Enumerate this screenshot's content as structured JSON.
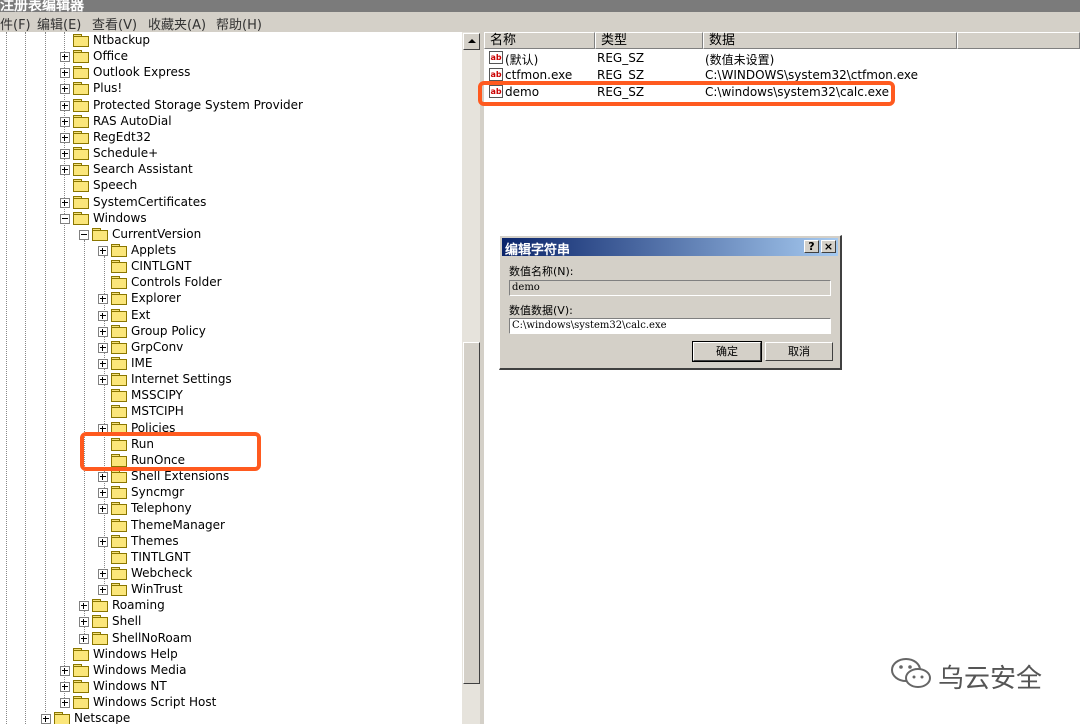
{
  "app": {
    "title": "注册表编辑器"
  },
  "menu": [
    "件(F)",
    "编辑(E)",
    "查看(V)",
    "收藏夹(A)",
    "帮助(H)"
  ],
  "tree": [
    {
      "label": "Ntbackup",
      "level": 3,
      "exp": "none"
    },
    {
      "label": "Office",
      "level": 3,
      "exp": "plus"
    },
    {
      "label": "Outlook Express",
      "level": 3,
      "exp": "plus"
    },
    {
      "label": "Plus!",
      "level": 3,
      "exp": "plus"
    },
    {
      "label": "Protected Storage System Provider",
      "level": 3,
      "exp": "plus"
    },
    {
      "label": "RAS AutoDial",
      "level": 3,
      "exp": "plus"
    },
    {
      "label": "RegEdt32",
      "level": 3,
      "exp": "plus"
    },
    {
      "label": "Schedule+",
      "level": 3,
      "exp": "plus"
    },
    {
      "label": "Search Assistant",
      "level": 3,
      "exp": "plus"
    },
    {
      "label": "Speech",
      "level": 3,
      "exp": "none"
    },
    {
      "label": "SystemCertificates",
      "level": 3,
      "exp": "plus"
    },
    {
      "label": "Windows",
      "level": 3,
      "exp": "minus"
    },
    {
      "label": "CurrentVersion",
      "level": 4,
      "exp": "minus"
    },
    {
      "label": "Applets",
      "level": 5,
      "exp": "plus"
    },
    {
      "label": "CINTLGNT",
      "level": 5,
      "exp": "none"
    },
    {
      "label": "Controls Folder",
      "level": 5,
      "exp": "none"
    },
    {
      "label": "Explorer",
      "level": 5,
      "exp": "plus"
    },
    {
      "label": "Ext",
      "level": 5,
      "exp": "plus"
    },
    {
      "label": "Group Policy",
      "level": 5,
      "exp": "plus"
    },
    {
      "label": "GrpConv",
      "level": 5,
      "exp": "plus"
    },
    {
      "label": "IME",
      "level": 5,
      "exp": "plus"
    },
    {
      "label": "Internet Settings",
      "level": 5,
      "exp": "plus"
    },
    {
      "label": "MSSCIPY",
      "level": 5,
      "exp": "none"
    },
    {
      "label": "MSTCIPH",
      "level": 5,
      "exp": "none"
    },
    {
      "label": "Policies",
      "level": 5,
      "exp": "plus"
    },
    {
      "label": "Run",
      "level": 5,
      "exp": "none",
      "open": true
    },
    {
      "label": "RunOnce",
      "level": 5,
      "exp": "none"
    },
    {
      "label": "Shell Extensions",
      "level": 5,
      "exp": "plus"
    },
    {
      "label": "Syncmgr",
      "level": 5,
      "exp": "plus"
    },
    {
      "label": "Telephony",
      "level": 5,
      "exp": "plus"
    },
    {
      "label": "ThemeManager",
      "level": 5,
      "exp": "none"
    },
    {
      "label": "Themes",
      "level": 5,
      "exp": "plus"
    },
    {
      "label": "TINTLGNT",
      "level": 5,
      "exp": "none"
    },
    {
      "label": "Webcheck",
      "level": 5,
      "exp": "plus"
    },
    {
      "label": "WinTrust",
      "level": 5,
      "exp": "plus"
    },
    {
      "label": "Roaming",
      "level": 4,
      "exp": "plus"
    },
    {
      "label": "Shell",
      "level": 4,
      "exp": "plus"
    },
    {
      "label": "ShellNoRoam",
      "level": 4,
      "exp": "plus"
    },
    {
      "label": "Windows Help",
      "level": 3,
      "exp": "none"
    },
    {
      "label": "Windows Media",
      "level": 3,
      "exp": "plus"
    },
    {
      "label": "Windows NT",
      "level": 3,
      "exp": "plus"
    },
    {
      "label": "Windows Script Host",
      "level": 3,
      "exp": "plus"
    },
    {
      "label": "Netscape",
      "level": 2,
      "exp": "plus"
    }
  ],
  "list": {
    "columns": [
      "名称",
      "类型",
      "数据"
    ],
    "rows": [
      {
        "name": "(默认)",
        "type": "REG_SZ",
        "data": "(数值未设置)"
      },
      {
        "name": "ctfmon.exe",
        "type": "REG_SZ",
        "data": "C:\\WINDOWS\\system32\\ctfmon.exe"
      },
      {
        "name": "demo",
        "type": "REG_SZ",
        "data": "C:\\windows\\system32\\calc.exe"
      }
    ]
  },
  "dialog": {
    "title": "编辑字符串",
    "help": "?",
    "close": "×",
    "name_label": "数值名称(N):",
    "name_value": "demo",
    "data_label": "数值数据(V):",
    "data_value": "C:\\windows\\system32\\calc.exe",
    "ok": "确定",
    "cancel": "取消"
  },
  "watermark": "乌云安全",
  "colors": {
    "highlight": "#ff5a1f",
    "folder": "#fbe67a",
    "dialog_title": "#0a246a"
  }
}
